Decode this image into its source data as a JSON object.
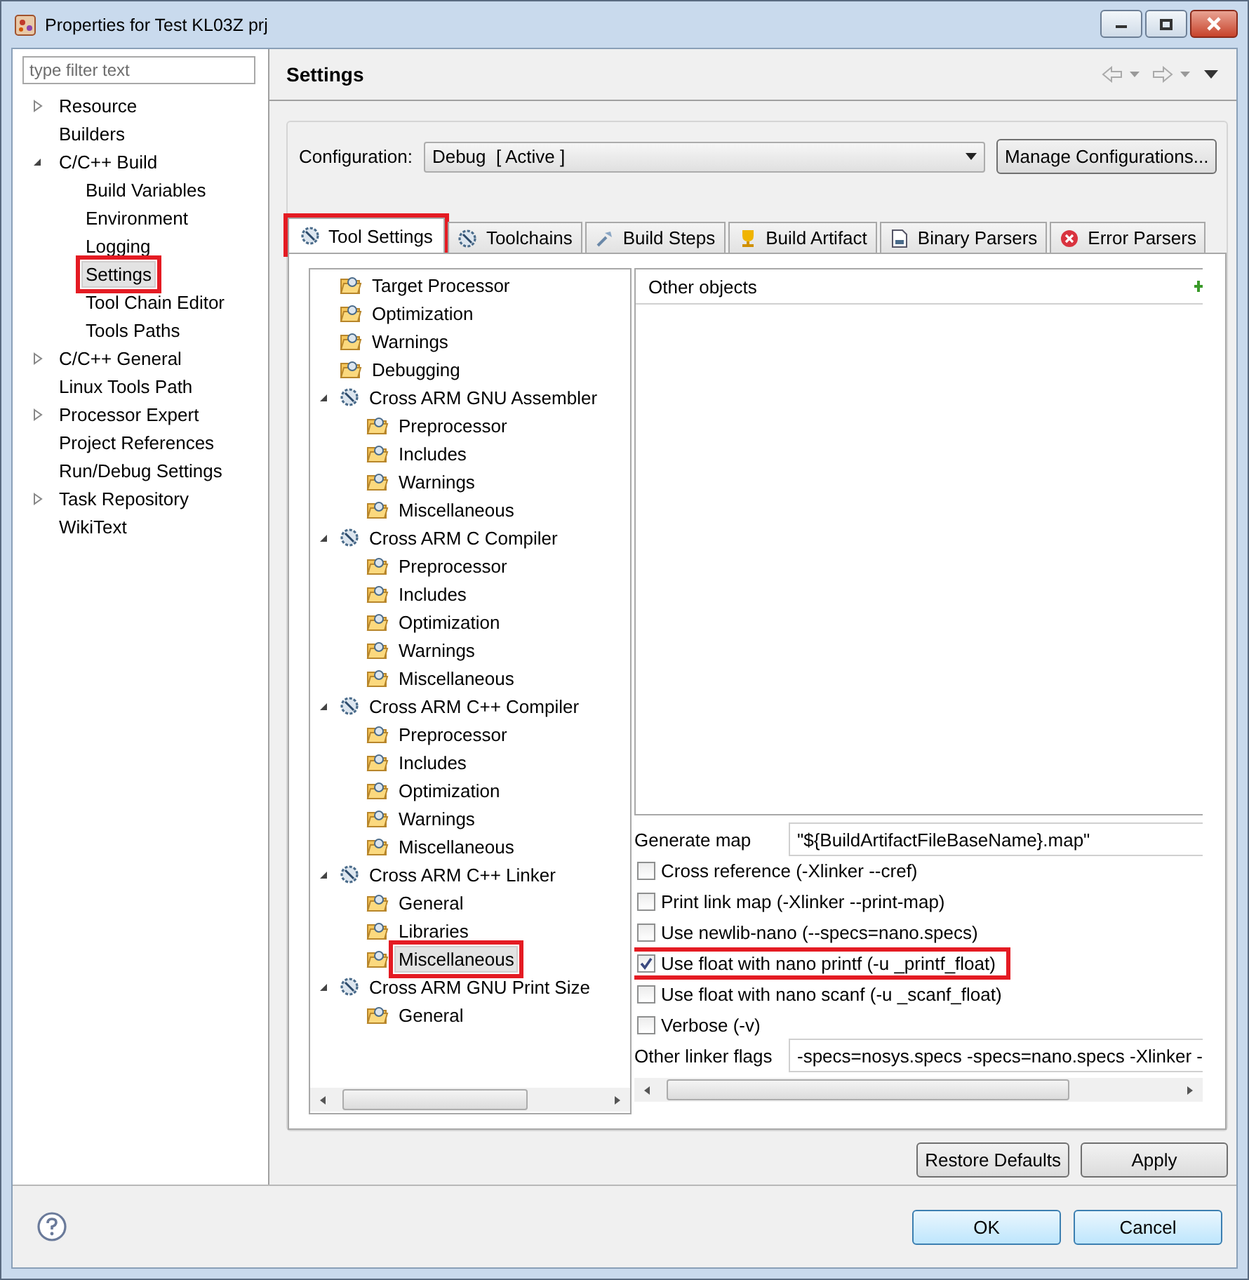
{
  "window": {
    "title": "Properties for Test KL03Z prj"
  },
  "filter": {
    "placeholder": "type filter text"
  },
  "nav": [
    {
      "label": "Resource",
      "expanded": false,
      "selected": false,
      "highlighted": false
    },
    {
      "label": "Builders",
      "selected": false,
      "highlighted": false
    },
    {
      "label": "C/C++ Build",
      "expanded": true,
      "selected": false,
      "highlighted": false,
      "children": [
        {
          "label": "Build Variables",
          "selected": false,
          "highlighted": false
        },
        {
          "label": "Environment",
          "selected": false,
          "highlighted": false
        },
        {
          "label": "Logging",
          "selected": false,
          "highlighted": false
        },
        {
          "label": "Settings",
          "selected": true,
          "highlighted": true
        },
        {
          "label": "Tool Chain Editor",
          "selected": false,
          "highlighted": false
        },
        {
          "label": "Tools Paths",
          "selected": false,
          "highlighted": false
        }
      ]
    },
    {
      "label": "C/C++ General",
      "expanded": false,
      "selected": false,
      "highlighted": false
    },
    {
      "label": "Linux Tools Path",
      "selected": false,
      "highlighted": false
    },
    {
      "label": "Processor Expert",
      "expanded": false,
      "selected": false,
      "highlighted": false
    },
    {
      "label": "Project References",
      "selected": false,
      "highlighted": false
    },
    {
      "label": "Run/Debug Settings",
      "selected": false,
      "highlighted": false
    },
    {
      "label": "Task Repository",
      "expanded": false,
      "selected": false,
      "highlighted": false
    },
    {
      "label": "WikiText",
      "selected": false,
      "highlighted": false
    }
  ],
  "page_title": "Settings",
  "configuration": {
    "label": "Configuration:",
    "value": "Debug  [ Active ]",
    "button": "Manage Configurations..."
  },
  "tabs": [
    {
      "label": "Tool Settings",
      "selected": true,
      "highlighted": true
    },
    {
      "label": "Toolchains",
      "selected": false,
      "highlighted": false
    },
    {
      "label": "Build Steps",
      "selected": false,
      "highlighted": false
    },
    {
      "label": "Build Artifact",
      "selected": false,
      "highlighted": false
    },
    {
      "label": "Binary Parsers",
      "selected": false,
      "highlighted": false
    },
    {
      "label": "Error Parsers",
      "selected": false,
      "highlighted": false
    }
  ],
  "tree": [
    {
      "kind": "category",
      "label": "Target Processor",
      "selected": false,
      "highlighted": false
    },
    {
      "kind": "category",
      "label": "Optimization",
      "selected": false,
      "highlighted": false
    },
    {
      "kind": "category",
      "label": "Warnings",
      "selected": false,
      "highlighted": false
    },
    {
      "kind": "category",
      "label": "Debugging",
      "selected": false,
      "highlighted": false
    },
    {
      "kind": "tool",
      "label": "Cross ARM GNU Assembler",
      "expanded": true,
      "selected": false,
      "highlighted": false,
      "children": [
        {
          "kind": "category",
          "label": "Preprocessor",
          "selected": false,
          "highlighted": false
        },
        {
          "kind": "category",
          "label": "Includes",
          "selected": false,
          "highlighted": false
        },
        {
          "kind": "category",
          "label": "Warnings",
          "selected": false,
          "highlighted": false
        },
        {
          "kind": "category",
          "label": "Miscellaneous",
          "selected": false,
          "highlighted": false
        }
      ]
    },
    {
      "kind": "tool",
      "label": "Cross ARM C Compiler",
      "expanded": true,
      "selected": false,
      "highlighted": false,
      "children": [
        {
          "kind": "category",
          "label": "Preprocessor",
          "selected": false,
          "highlighted": false
        },
        {
          "kind": "category",
          "label": "Includes",
          "selected": false,
          "highlighted": false
        },
        {
          "kind": "category",
          "label": "Optimization",
          "selected": false,
          "highlighted": false
        },
        {
          "kind": "category",
          "label": "Warnings",
          "selected": false,
          "highlighted": false
        },
        {
          "kind": "category",
          "label": "Miscellaneous",
          "selected": false,
          "highlighted": false
        }
      ]
    },
    {
      "kind": "tool",
      "label": "Cross ARM C++ Compiler",
      "expanded": true,
      "selected": false,
      "highlighted": false,
      "children": [
        {
          "kind": "category",
          "label": "Preprocessor",
          "selected": false,
          "highlighted": false
        },
        {
          "kind": "category",
          "label": "Includes",
          "selected": false,
          "highlighted": false
        },
        {
          "kind": "category",
          "label": "Optimization",
          "selected": false,
          "highlighted": false
        },
        {
          "kind": "category",
          "label": "Warnings",
          "selected": false,
          "highlighted": false
        },
        {
          "kind": "category",
          "label": "Miscellaneous",
          "selected": false,
          "highlighted": false
        }
      ]
    },
    {
      "kind": "tool",
      "label": "Cross ARM C++ Linker",
      "expanded": true,
      "selected": false,
      "highlighted": false,
      "children": [
        {
          "kind": "category",
          "label": "General",
          "selected": false,
          "highlighted": false
        },
        {
          "kind": "category",
          "label": "Libraries",
          "selected": false,
          "highlighted": false
        },
        {
          "kind": "category",
          "label": "Miscellaneous",
          "selected": true,
          "highlighted": true
        }
      ]
    },
    {
      "kind": "tool",
      "label": "Cross ARM GNU Print Size",
      "expanded": true,
      "selected": false,
      "highlighted": false,
      "children": [
        {
          "kind": "category",
          "label": "General",
          "selected": false,
          "highlighted": false
        }
      ]
    }
  ],
  "options": {
    "list_header": "Other objects",
    "rows": [
      {
        "kind": "text",
        "label": "Generate map",
        "value": "\"${BuildArtifactFileBaseName}.map\""
      },
      {
        "kind": "checkbox",
        "label": "Cross reference (-Xlinker --cref)",
        "checked": false,
        "highlighted": false
      },
      {
        "kind": "checkbox",
        "label": "Print link map (-Xlinker --print-map)",
        "checked": false,
        "highlighted": false
      },
      {
        "kind": "checkbox",
        "label": "Use newlib-nano (--specs=nano.specs)",
        "checked": false,
        "highlighted": false
      },
      {
        "kind": "checkbox",
        "label": "Use float with nano printf (-u _printf_float)",
        "checked": true,
        "highlighted": true
      },
      {
        "kind": "checkbox",
        "label": "Use float with nano scanf (-u _scanf_float)",
        "checked": false,
        "highlighted": false
      },
      {
        "kind": "checkbox",
        "label": "Verbose (-v)",
        "checked": false,
        "highlighted": false
      },
      {
        "kind": "text",
        "label": "Other linker flags",
        "value": "-specs=nosys.specs -specs=nano.specs -Xlinker -"
      }
    ]
  },
  "page_buttons": [
    "Restore Defaults",
    "Apply"
  ],
  "dialog_buttons": [
    "OK",
    "Cancel"
  ]
}
